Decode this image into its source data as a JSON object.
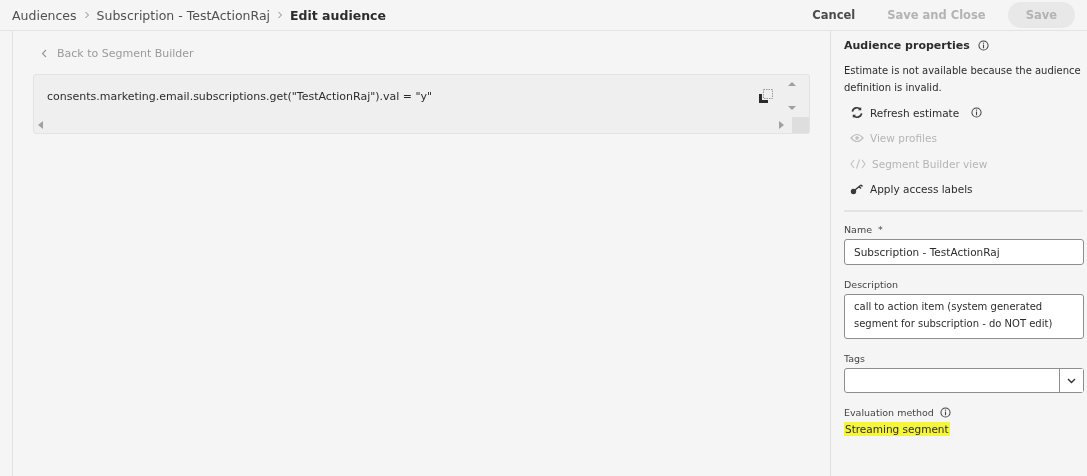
{
  "breadcrumbs": [
    {
      "label": "Audiences",
      "current": false
    },
    {
      "label": "Subscription - TestActionRaj",
      "current": false
    },
    {
      "label": "Edit audience",
      "current": true
    }
  ],
  "header_buttons": [
    {
      "label": "Cancel",
      "disabled": false,
      "kind": "text"
    },
    {
      "label": "Save and Close",
      "disabled": true,
      "kind": "text"
    },
    {
      "label": "Save",
      "disabled": true,
      "kind": "filled"
    }
  ],
  "back_link": "Back to Segment Builder",
  "code_editor": {
    "text": "consents.marketing.email.subscriptions.get(\"TestActionRaj\").val = \"y\""
  },
  "properties": {
    "title": "Audience properties",
    "estimate_message": "Estimate is not available because the audience definition is invalid.",
    "actions": [
      {
        "label": "Refresh estimate",
        "kind": "refresh",
        "disabled": false,
        "info": true
      },
      {
        "label": "View profiles",
        "kind": "eye",
        "disabled": true,
        "info": false
      },
      {
        "label": "Segment Builder view",
        "kind": "code",
        "disabled": true,
        "info": false
      },
      {
        "label": "Apply access labels",
        "kind": "key",
        "disabled": false,
        "info": false
      }
    ],
    "name": {
      "label": "Name",
      "required_mark": "*",
      "value": "Subscription - TestActionRaj"
    },
    "description": {
      "label": "Description",
      "value": "call to action item (system generated segment for subscription - do NOT edit)"
    },
    "tags": {
      "label": "Tags"
    },
    "evaluation_method": {
      "label": "Evaluation method",
      "value": "Streaming segment",
      "highlighted": true
    }
  }
}
